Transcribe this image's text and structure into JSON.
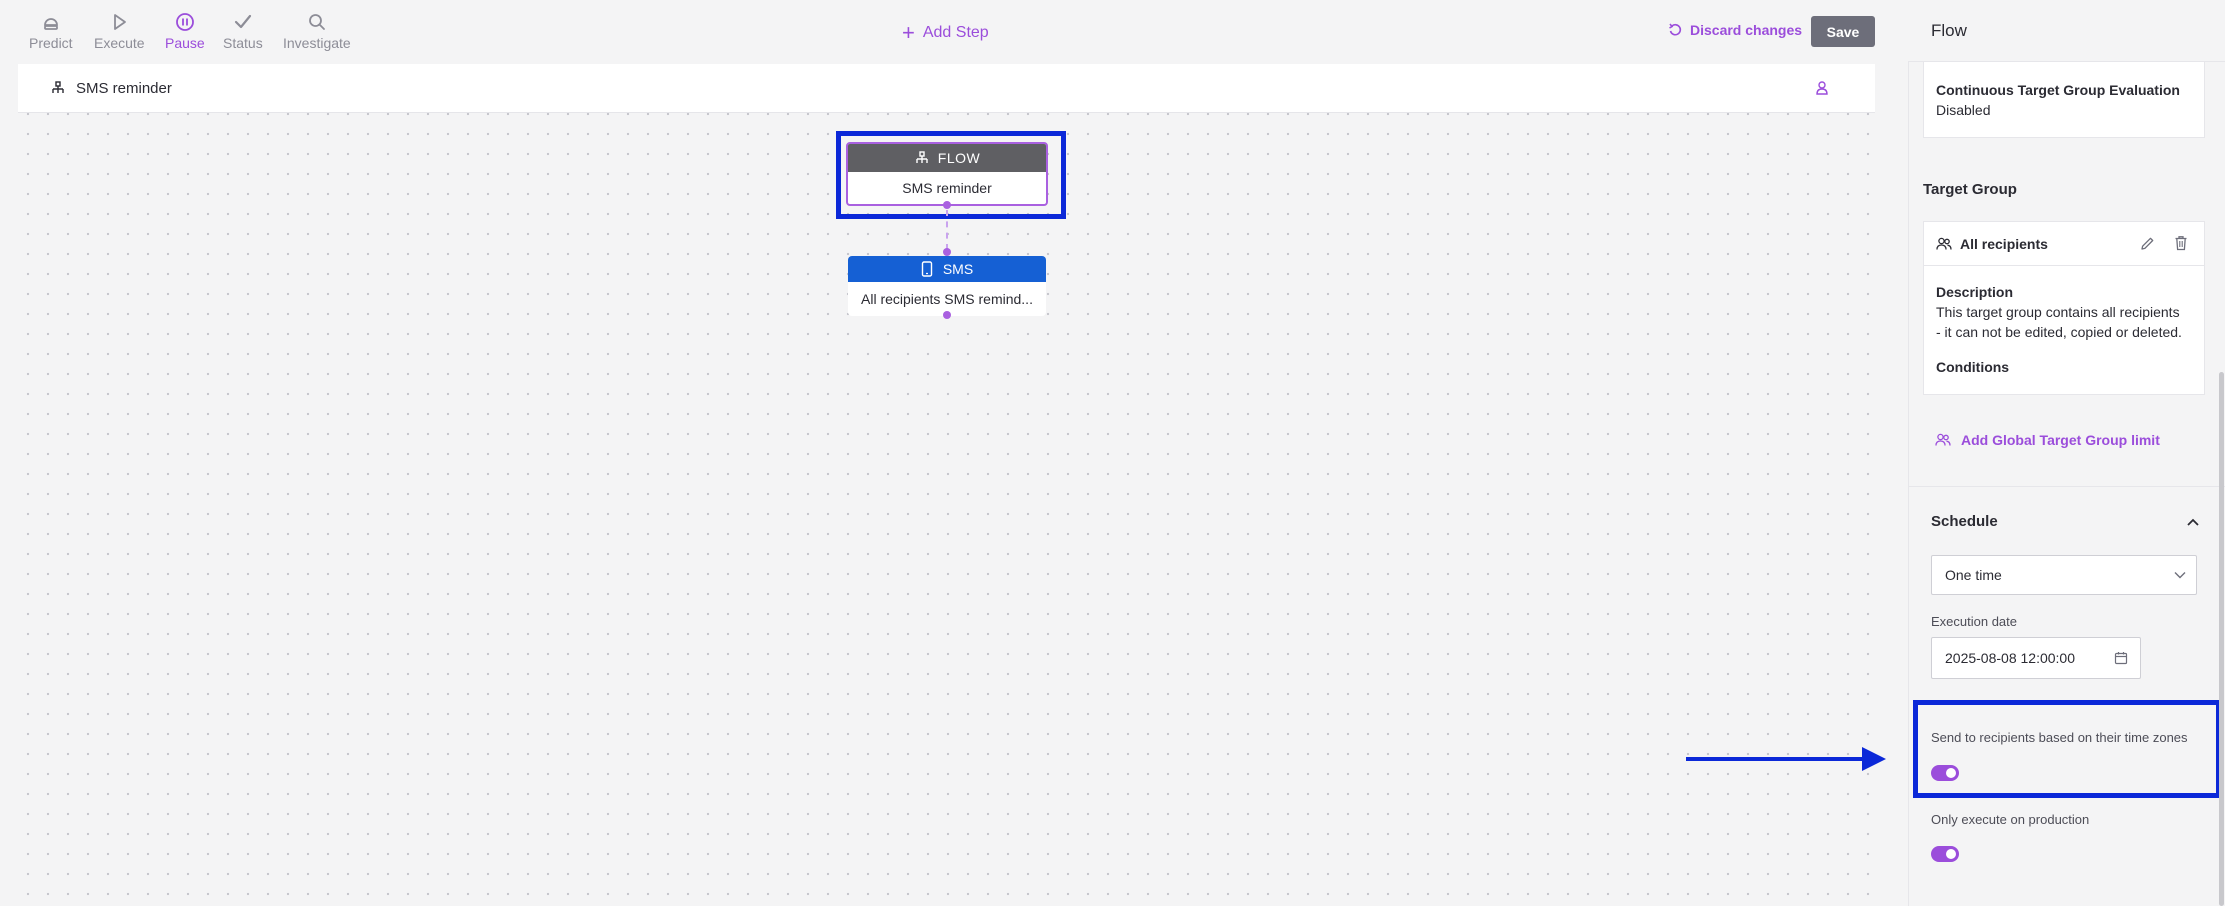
{
  "toolbar": {
    "items": [
      {
        "label": "Predict",
        "icon": "predict-icon",
        "active": false
      },
      {
        "label": "Execute",
        "icon": "play-icon",
        "active": false
      },
      {
        "label": "Pause",
        "icon": "pause-icon",
        "active": true
      },
      {
        "label": "Status",
        "icon": "check-icon",
        "active": false
      },
      {
        "label": "Investigate",
        "icon": "search-icon",
        "active": false
      }
    ],
    "add_step_label": "Add Step",
    "discard_label": "Discard changes",
    "save_label": "Save"
  },
  "breadcrumb": {
    "label": "SMS reminder"
  },
  "canvas": {
    "flow_node": {
      "header": "FLOW",
      "body": "SMS reminder"
    },
    "sms_node": {
      "header": "SMS",
      "body": "All recipients SMS remind..."
    }
  },
  "panel": {
    "title": "Flow",
    "continuous_eval": {
      "label": "Continuous Target Group Evaluation",
      "value": "Disabled"
    },
    "target_group": {
      "heading": "Target Group",
      "name": "All recipients",
      "description_label": "Description",
      "description_lines": [
        "This target group contains all recipients",
        "- it can not be edited, copied or deleted."
      ],
      "conditions_label": "Conditions"
    },
    "add_global_limit": "Add Global Target Group limit",
    "schedule": {
      "title": "Schedule",
      "frequency": "One time",
      "execution_date_label": "Execution date",
      "execution_date": "2025-08-08 12:00:00",
      "timezone_label": "Send to recipients based on their time zones",
      "timezone_enabled": true,
      "production_label": "Only execute on production",
      "production_enabled": true
    }
  },
  "colors": {
    "accent": "#9b4ddb",
    "flow_header": "#5f5f63",
    "sms_header": "#1560d4",
    "annotation": "#0b28d8",
    "save_button": "#6d6e7a"
  }
}
